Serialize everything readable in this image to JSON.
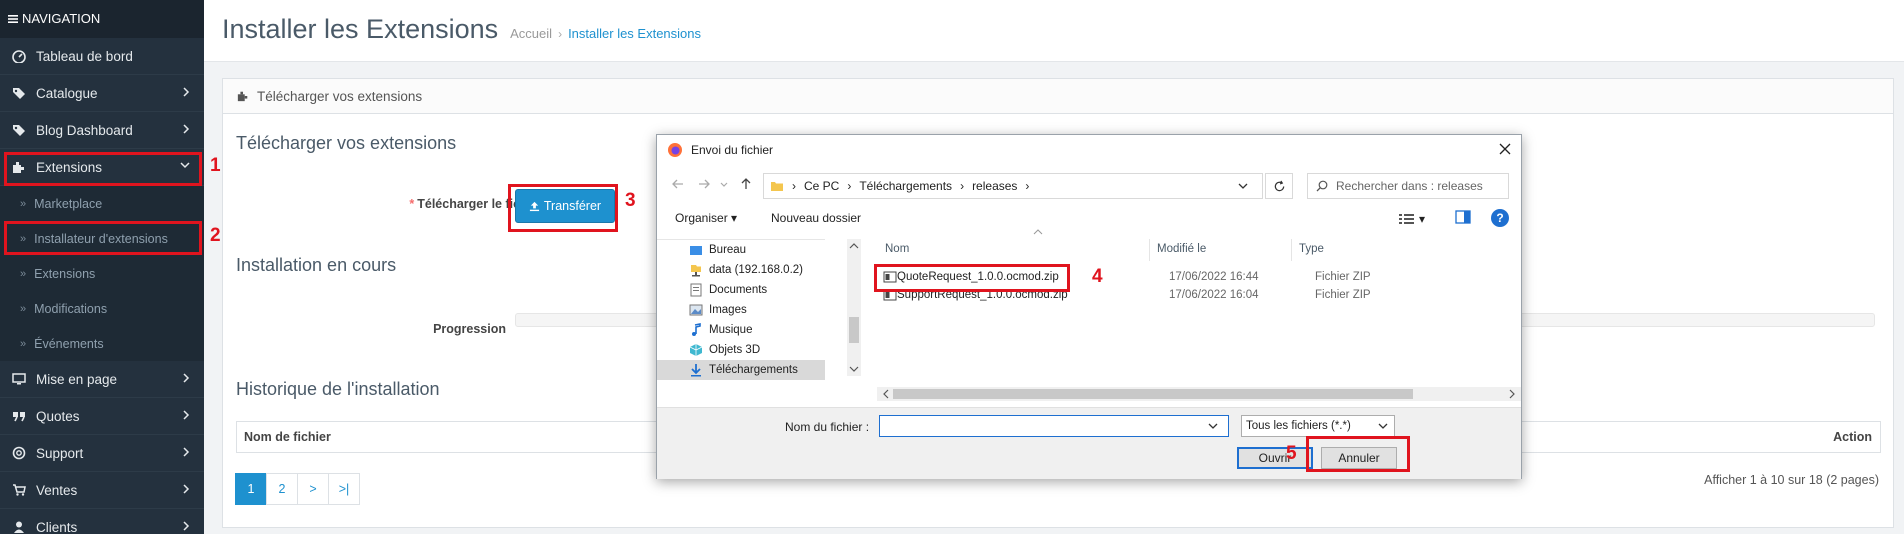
{
  "sidebar": {
    "header": "NAVIGATION",
    "items": [
      {
        "label": "Tableau de bord",
        "icon": "dashboard-icon"
      },
      {
        "label": "Catalogue",
        "icon": "tag-icon"
      },
      {
        "label": "Blog Dashboard",
        "icon": "tag-icon"
      },
      {
        "label": "Extensions",
        "icon": "puzzle-icon"
      },
      {
        "label": "Mise en page",
        "icon": "monitor-icon"
      },
      {
        "label": "Quotes",
        "icon": "quote-icon"
      },
      {
        "label": "Support",
        "icon": "lifebuoy-icon"
      },
      {
        "label": "Ventes",
        "icon": "cart-icon"
      },
      {
        "label": "Clients",
        "icon": "user-icon"
      }
    ],
    "submenu": [
      "Marketplace",
      "Installateur d'extensions",
      "Extensions",
      "Modifications",
      "Événements"
    ]
  },
  "page": {
    "title": "Installer les Extensions",
    "breadcrumb": [
      "Accueil",
      "Installer les Extensions"
    ]
  },
  "panel": {
    "heading": "Télécharger vos extensions",
    "upload_title": "Télécharger vos extensions",
    "upload_label": "Télécharger le fichier",
    "upload_required": "*",
    "upload_help": "?",
    "upload_button": "Transférer",
    "install_title": "Installation en cours",
    "progress_label": "Progression",
    "progress_value": 0,
    "history_title": "Historique de l'installation",
    "table_headers": [
      "Nom de fichier",
      "Action"
    ],
    "pagination": [
      "1",
      "2",
      ">",
      ">|"
    ],
    "page_info": "Afficher 1 à 10 sur 18 (2 pages)"
  },
  "annotations": [
    "1",
    "2",
    "3",
    "4",
    "5"
  ],
  "dialog": {
    "title": "Envoi du fichier",
    "path": [
      "Ce PC",
      "Téléchargements",
      "releases"
    ],
    "search_placeholder": "Rechercher dans : releases",
    "toolbar": {
      "organize": "Organiser",
      "new_folder": "Nouveau dossier"
    },
    "nav_items": [
      {
        "label": "Bureau",
        "icon": "desktop-folder-icon"
      },
      {
        "label": "data (192.168.0.2)",
        "icon": "network-drive-icon"
      },
      {
        "label": "Documents",
        "icon": "documents-folder-icon"
      },
      {
        "label": "Images",
        "icon": "images-folder-icon"
      },
      {
        "label": "Musique",
        "icon": "music-folder-icon"
      },
      {
        "label": "Objets 3D",
        "icon": "objects-3d-icon"
      },
      {
        "label": "Téléchargements",
        "icon": "downloads-folder-icon"
      }
    ],
    "columns": [
      "Nom",
      "Modifié le",
      "Type"
    ],
    "files": [
      {
        "name": "QuoteRequest_1.0.0.ocmod.zip",
        "modified": "17/06/2022 16:44",
        "type": "Fichier ZIP"
      },
      {
        "name": "SupportRequest_1.0.0.ocmod.zip",
        "modified": "17/06/2022 16:04",
        "type": "Fichier ZIP"
      }
    ],
    "filename_label": "Nom du fichier :",
    "filename_value": "",
    "filetype": "Tous les fichiers (*.*)",
    "open_button": "Ouvrir",
    "cancel_button": "Annuler"
  },
  "colors": {
    "accent": "#1e91cf",
    "annotation": "#e0141e",
    "sidebar": "#24313e"
  }
}
